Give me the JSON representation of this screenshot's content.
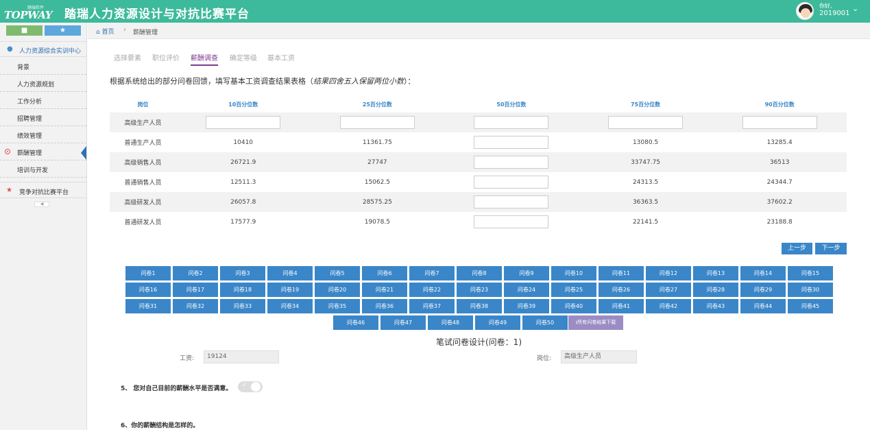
{
  "header": {
    "logo_top": "踏瑞软件",
    "logo_main": "TOPWAY",
    "title": "踏瑞人力资源设计与对抗比赛平台",
    "greeting": "你好,",
    "user_id": "2019001"
  },
  "sidebar": {
    "section_title": "人力资源综合实训中心",
    "items": [
      {
        "label": "背景"
      },
      {
        "label": "人力资源规划"
      },
      {
        "label": "工作分析"
      },
      {
        "label": "招聘管理"
      },
      {
        "label": "绩效管理"
      },
      {
        "label": "薪酬管理"
      },
      {
        "label": "培训与开发"
      }
    ],
    "competition_label": "竞争对抗比赛平台"
  },
  "breadcrumb": {
    "home": "首页",
    "current": "薪酬管理"
  },
  "steps": [
    "选择要素",
    "职位评价",
    "薪酬调查",
    "确定等级",
    "基本工资"
  ],
  "instruction": {
    "main": "根据系统给出的部分问卷回馈，填写基本工资调查结果表格（",
    "italic": "结果四舍五入保留两位小数",
    "end": "）："
  },
  "table": {
    "headers": [
      "岗位",
      "10百分位数",
      "25百分位数",
      "50百分位数",
      "75百分位数",
      "90百分位数"
    ],
    "rows": [
      {
        "post": "高级生产人员",
        "p10": "",
        "p25": "",
        "p75": "",
        "p90": ""
      },
      {
        "post": "普通生产人员",
        "p10": "10410",
        "p25": "11361.75",
        "p75": "13080.5",
        "p90": "13285.4"
      },
      {
        "post": "高级销售人员",
        "p10": "26721.9",
        "p25": "27747",
        "p75": "33747.75",
        "p90": "36513"
      },
      {
        "post": "普通销售人员",
        "p10": "12511.3",
        "p25": "15062.5",
        "p75": "24313.5",
        "p90": "24344.7"
      },
      {
        "post": "高级研发人员",
        "p10": "26057.8",
        "p25": "28575.25",
        "p75": "36363.5",
        "p90": "37602.2"
      },
      {
        "post": "普通研发人员",
        "p10": "17577.9",
        "p25": "19078.5",
        "p75": "22141.5",
        "p90": "23188.8"
      }
    ]
  },
  "nav": {
    "prev": "上一步",
    "next": "下一步"
  },
  "questionnaires": [
    "问卷1",
    "问卷2",
    "问卷3",
    "问卷4",
    "问卷5",
    "问卷6",
    "问卷7",
    "问卷8",
    "问卷9",
    "问卷10",
    "问卷11",
    "问卷12",
    "问卷13",
    "问卷14",
    "问卷15",
    "问卷16",
    "问卷17",
    "问卷18",
    "问卷19",
    "问卷20",
    "问卷21",
    "问卷22",
    "问卷23",
    "问卷24",
    "问卷25",
    "问卷26",
    "问卷27",
    "问卷28",
    "问卷29",
    "问卷30",
    "问卷31",
    "问卷32",
    "问卷33",
    "问卷34",
    "问卷35",
    "问卷36",
    "问卷37",
    "问卷38",
    "问卷39",
    "问卷40",
    "问卷41",
    "问卷42",
    "问卷43",
    "问卷44",
    "问卷45",
    "问卷46",
    "问卷47",
    "问卷48",
    "问卷49",
    "问卷50"
  ],
  "download_all": "所有问卷结果下载",
  "detail": {
    "title": "笔试问卷设计(问卷：1)",
    "salary_label": "工资:",
    "salary_value": "19124",
    "post_label": "岗位:",
    "post_value": "高级生产人员",
    "q5": "5、 您对自己目前的薪酬水平是否满意。",
    "q6": "6、你的薪酬结构是怎样的。"
  },
  "colors": {
    "header": "#3dba9b",
    "primary": "#3a86c8",
    "active_step": "#7b3b8f",
    "download": "#9b8cc4"
  }
}
